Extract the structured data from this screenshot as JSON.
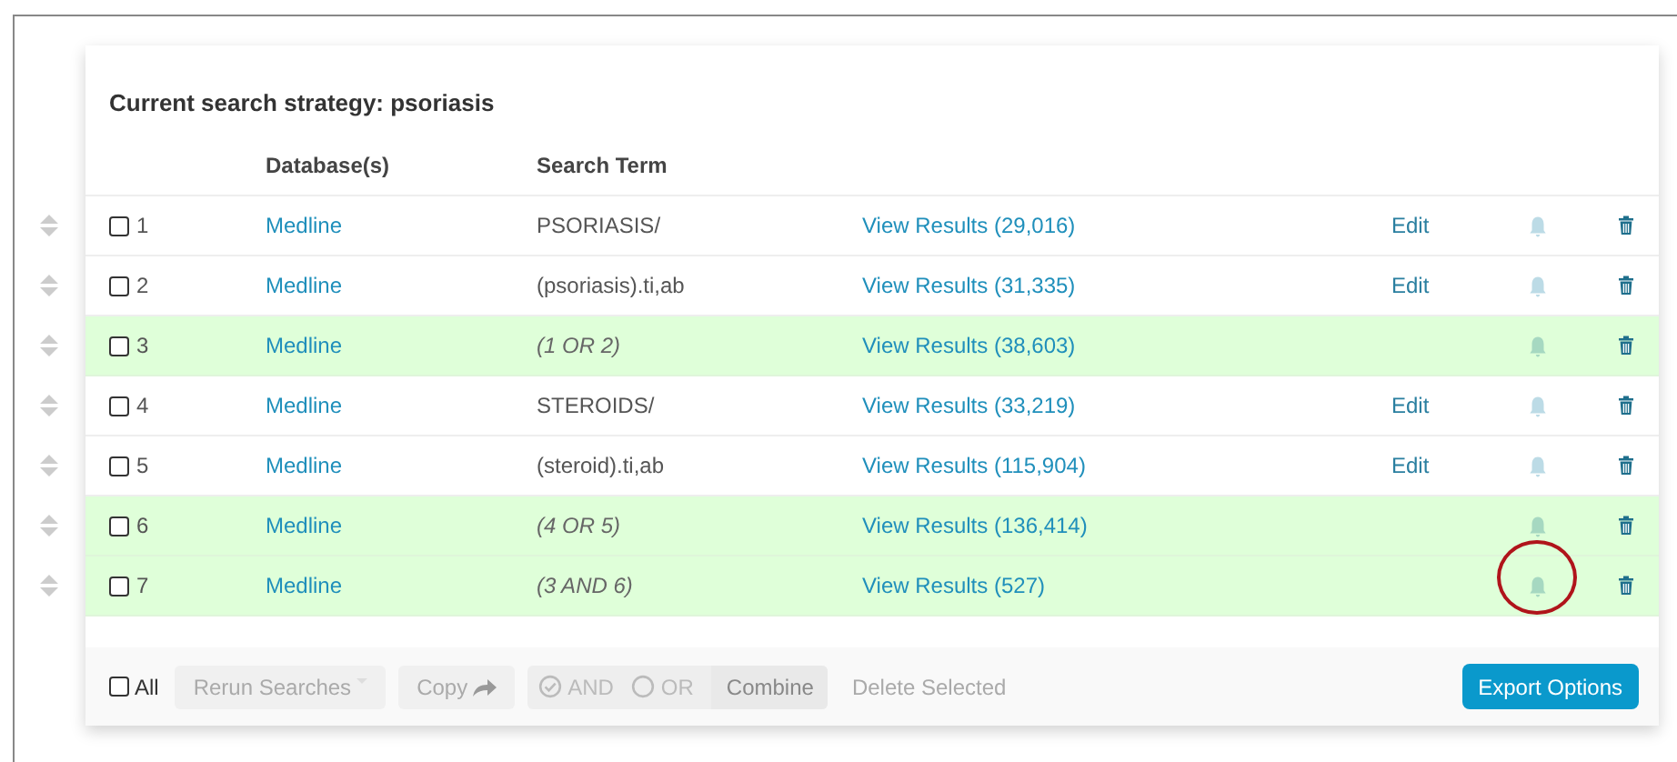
{
  "strategy": {
    "title": "Current search strategy: psoriasis"
  },
  "columns": [
    {
      "label": "Database(s)"
    },
    {
      "label": "Search Term"
    }
  ],
  "rows": [
    {
      "kind": "search",
      "number": "1",
      "checked": false,
      "database": "Medline",
      "term": "PSORIASIS/",
      "results": "View Results (29,016)",
      "edit": "Edit",
      "circled": false
    },
    {
      "kind": "search",
      "number": "2",
      "checked": false,
      "database": "Medline",
      "term": "(psoriasis).ti,ab",
      "results": "View Results (31,335)",
      "edit": "Edit",
      "circled": false
    },
    {
      "kind": "combined",
      "number": "3",
      "checked": false,
      "database": "Medline",
      "term": "(1 OR 2)",
      "results": "View Results (38,603)",
      "circled": false
    },
    {
      "kind": "search",
      "number": "4",
      "checked": false,
      "database": "Medline",
      "term": "STEROIDS/",
      "results": "View Results (33,219)",
      "edit": "Edit",
      "circled": false
    },
    {
      "kind": "search",
      "number": "5",
      "checked": false,
      "database": "Medline",
      "term": "(steroid).ti,ab",
      "results": "View Results (115,904)",
      "edit": "Edit",
      "circled": false
    },
    {
      "kind": "combined",
      "number": "6",
      "checked": false,
      "database": "Medline",
      "term": "(4 OR 5)",
      "results": "View Results (136,414)",
      "circled": false
    },
    {
      "kind": "combined",
      "number": "7",
      "checked": false,
      "database": "Medline",
      "term": "(3 AND 6)",
      "results": "View Results (527)",
      "circled": true
    }
  ],
  "footer": {
    "select_all": {
      "label": "All",
      "checked": false
    },
    "rerun": {
      "label": "Rerun Searches",
      "disabled": true
    },
    "copy": {
      "label": "Copy",
      "disabled": true
    },
    "combine": {
      "options": [
        {
          "label": "AND",
          "selected": true
        },
        {
          "label": "OR",
          "selected": false
        }
      ],
      "label": "Combine",
      "disabled": true
    },
    "delete": {
      "label": "Delete Selected",
      "disabled": true
    },
    "export": {
      "label": "Export Options"
    }
  }
}
